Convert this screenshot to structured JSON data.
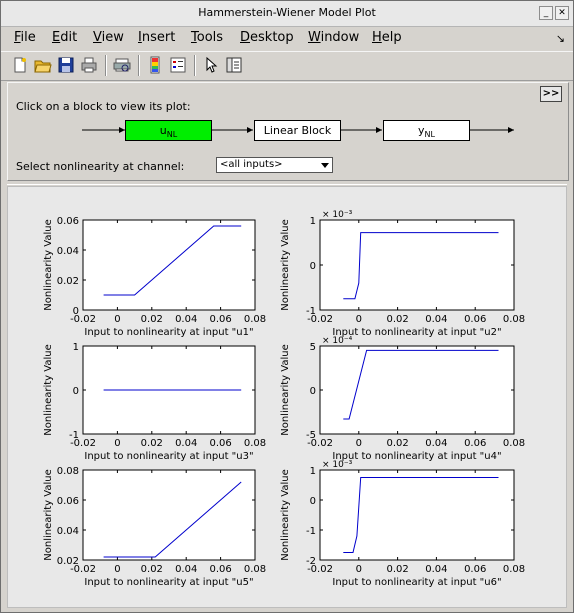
{
  "window": {
    "title": "Hammerstein-Wiener Model Plot"
  },
  "menu": [
    {
      "label": "File",
      "u": "F",
      "rest": "ile"
    },
    {
      "label": "Edit",
      "u": "E",
      "rest": "dit"
    },
    {
      "label": "View",
      "u": "V",
      "rest": "iew"
    },
    {
      "label": "Insert",
      "u": "I",
      "rest": "nsert"
    },
    {
      "label": "Tools",
      "u": "T",
      "rest": "ools"
    },
    {
      "label": "Desktop",
      "u": "D",
      "rest": "esktop"
    },
    {
      "label": "Window",
      "u": "W",
      "rest": "indow"
    },
    {
      "label": "Help",
      "u": "H",
      "rest": "elp"
    }
  ],
  "toolbar": {
    "icons": [
      "new-file-icon",
      "open-folder-icon",
      "save-icon",
      "print-icon",
      "print-preview-icon",
      "colorbar-icon",
      "legend-icon",
      "pointer-icon",
      "property-editor-icon"
    ]
  },
  "panel": {
    "hint": "Click on a block to view its plot:",
    "toggle_label": ">>",
    "blocks": {
      "input_nl": {
        "main": "u",
        "sub": "NL"
      },
      "linear": "Linear Block",
      "output_nl": {
        "main": "y",
        "sub": "NL"
      }
    },
    "select_label": "Select nonlinearity at channel:",
    "select_value": "<all inputs>"
  },
  "colors": {
    "active_block": "#00ee00",
    "line": "#0000cc"
  },
  "chart_data": [
    {
      "type": "line",
      "xlabel": "Input to nonlinearity at input \"u1\"",
      "ylabel": "Nonlinearity Value",
      "xlim": [
        -0.02,
        0.08
      ],
      "ylim": [
        0,
        0.06
      ],
      "xticks": [
        "-0.02",
        "0",
        "0.02",
        "0.04",
        "0.06",
        "0.08"
      ],
      "yticks": [
        "0",
        "0.02",
        "0.04",
        "0.06"
      ],
      "exponent": "",
      "x": [
        -0.008,
        0.01,
        0.056,
        0.072
      ],
      "y": [
        0.01,
        0.01,
        0.056,
        0.056
      ]
    },
    {
      "type": "line",
      "xlabel": "Input to nonlinearity at input \"u2\"",
      "ylabel": "Nonlinearity Value",
      "xlim": [
        -0.02,
        0.08
      ],
      "ylim": [
        -1,
        1
      ],
      "xticks": [
        "-0.02",
        "0",
        "0.02",
        "0.04",
        "0.06",
        "0.08"
      ],
      "yticks": [
        "-1",
        "0",
        "1"
      ],
      "exponent": "× 10⁻³",
      "x": [
        -0.008,
        -0.002,
        0.0,
        0.001,
        0.072
      ],
      "y": [
        -0.75,
        -0.75,
        -0.4,
        0.72,
        0.72
      ]
    },
    {
      "type": "line",
      "xlabel": "Input to nonlinearity at input \"u3\"",
      "ylabel": "Nonlinearity Value",
      "xlim": [
        -0.02,
        0.08
      ],
      "ylim": [
        -1,
        1
      ],
      "xticks": [
        "-0.02",
        "0",
        "0.02",
        "0.04",
        "0.06",
        "0.08"
      ],
      "yticks": [
        "-1",
        "0",
        "1"
      ],
      "exponent": "",
      "x": [
        -0.008,
        0.072
      ],
      "y": [
        0,
        0
      ]
    },
    {
      "type": "line",
      "xlabel": "Input to nonlinearity at input \"u4\"",
      "ylabel": "Nonlinearity Value",
      "xlim": [
        -0.02,
        0.08
      ],
      "ylim": [
        -5,
        5
      ],
      "xticks": [
        "-0.02",
        "0",
        "0.02",
        "0.04",
        "0.06",
        "0.08"
      ],
      "yticks": [
        "-5",
        "0",
        "5"
      ],
      "exponent": "× 10⁻⁴",
      "x": [
        -0.008,
        -0.005,
        0.004,
        0.072
      ],
      "y": [
        -3.3,
        -3.3,
        4.5,
        4.5
      ]
    },
    {
      "type": "line",
      "xlabel": "Input to nonlinearity at input \"u5\"",
      "ylabel": "Nonlinearity Value",
      "xlim": [
        -0.02,
        0.08
      ],
      "ylim": [
        0.02,
        0.08
      ],
      "xticks": [
        "-0.02",
        "0",
        "0.02",
        "0.04",
        "0.06",
        "0.08"
      ],
      "yticks": [
        "0.02",
        "0.04",
        "0.06",
        "0.08"
      ],
      "exponent": "",
      "x": [
        -0.008,
        0.022,
        0.072
      ],
      "y": [
        0.022,
        0.022,
        0.072
      ]
    },
    {
      "type": "line",
      "xlabel": "Input to nonlinearity at input \"u6\"",
      "ylabel": "Nonlinearity Value",
      "xlim": [
        -0.02,
        0.08
      ],
      "ylim": [
        -2,
        1
      ],
      "xticks": [
        "-0.02",
        "0",
        "0.02",
        "0.04",
        "0.06",
        "0.08"
      ],
      "yticks": [
        "-2",
        "-1",
        "0",
        "1"
      ],
      "exponent": "× 10⁻³",
      "x": [
        -0.008,
        -0.003,
        -0.001,
        0.001,
        0.072
      ],
      "y": [
        -1.75,
        -1.75,
        -1.2,
        0.75,
        0.75
      ]
    }
  ]
}
